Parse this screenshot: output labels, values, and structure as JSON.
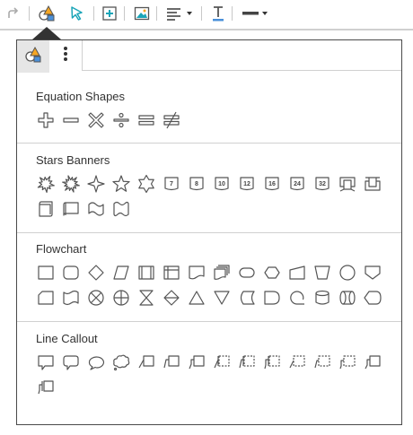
{
  "toolbar": {
    "items": [
      "redo-icon",
      "shapes-icon",
      "pointer-icon",
      "insert-textbox-icon",
      "image-icon",
      "align-icon",
      "text-color-icon",
      "line-style-icon"
    ]
  },
  "panel": {
    "tabs": [
      "shapes-icon",
      "more-options-icon"
    ],
    "sections": [
      {
        "title": "Equation Shapes",
        "shapes": [
          "plus",
          "minus",
          "multiply",
          "divide",
          "equal",
          "not-equal"
        ]
      },
      {
        "title": "Stars Banners",
        "shapes": [
          "explosion-1",
          "explosion-2",
          "star-4",
          "star-5",
          "star-6",
          "star-7",
          "star-8",
          "star-10",
          "star-12",
          "star-16",
          "star-24",
          "star-32",
          "ribbon-down",
          "ribbon-up",
          "scroll-vertical",
          "scroll-horizontal",
          "wave",
          "double-wave"
        ],
        "labels": {
          "star-7": "7",
          "star-8": "8",
          "star-10": "10",
          "star-12": "12",
          "star-16": "16",
          "star-24": "24",
          "star-32": "32"
        }
      },
      {
        "title": "Flowchart",
        "shapes": [
          "process",
          "alternate-process",
          "decision",
          "data",
          "predefined-process",
          "internal-storage",
          "document",
          "multidocument",
          "terminator",
          "preparation",
          "manual-input",
          "manual-operation",
          "connector",
          "offpage-connector",
          "card",
          "punched-tape",
          "summing-junction",
          "or",
          "collate",
          "sort",
          "extract",
          "merge",
          "stored-data",
          "delay",
          "sequential-storage",
          "magnetic-disk",
          "direct-access-storage",
          "display"
        ]
      },
      {
        "title": "Line Callout",
        "shapes": [
          "rect-callout",
          "rounded-rect-callout",
          "oval-callout",
          "cloud-callout",
          "line-callout-1",
          "line-callout-2",
          "line-callout-3",
          "line-callout-1-accent",
          "line-callout-2-accent",
          "line-callout-3-accent",
          "line-callout-1-border",
          "line-callout-2-border",
          "line-callout-3-border",
          "line-callout-4",
          "line-callout-4-accent"
        ]
      }
    ]
  }
}
